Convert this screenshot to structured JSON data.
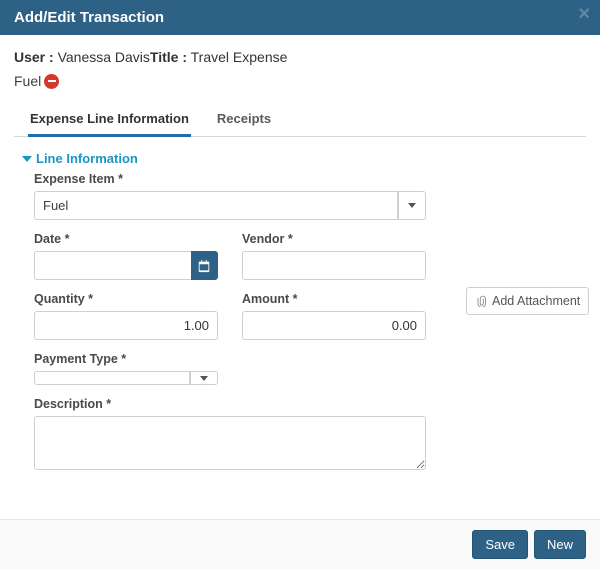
{
  "header": {
    "title": "Add/Edit Transaction"
  },
  "context": {
    "user_label": "User :",
    "user_value": " Vanessa Davis",
    "title_label": "Title :",
    "title_value": " Travel Expense",
    "line_name": "Fuel"
  },
  "tabs": {
    "expense": "Expense Line Information",
    "receipts": "Receipts"
  },
  "section": {
    "line_info": "Line Information"
  },
  "form": {
    "expense_item_label": "Expense Item *",
    "expense_item_value": "Fuel",
    "date_label": "Date *",
    "date_value": "",
    "vendor_label": "Vendor *",
    "vendor_value": "",
    "quantity_label": "Quantity *",
    "quantity_value": "1.00",
    "amount_label": "Amount *",
    "amount_value": "0.00",
    "payment_type_label": "Payment Type *",
    "payment_type_value": "",
    "description_label": "Description *",
    "description_value": ""
  },
  "attachments": {
    "add_label": "Add Attachment"
  },
  "footer": {
    "save": "Save",
    "new": "New"
  }
}
